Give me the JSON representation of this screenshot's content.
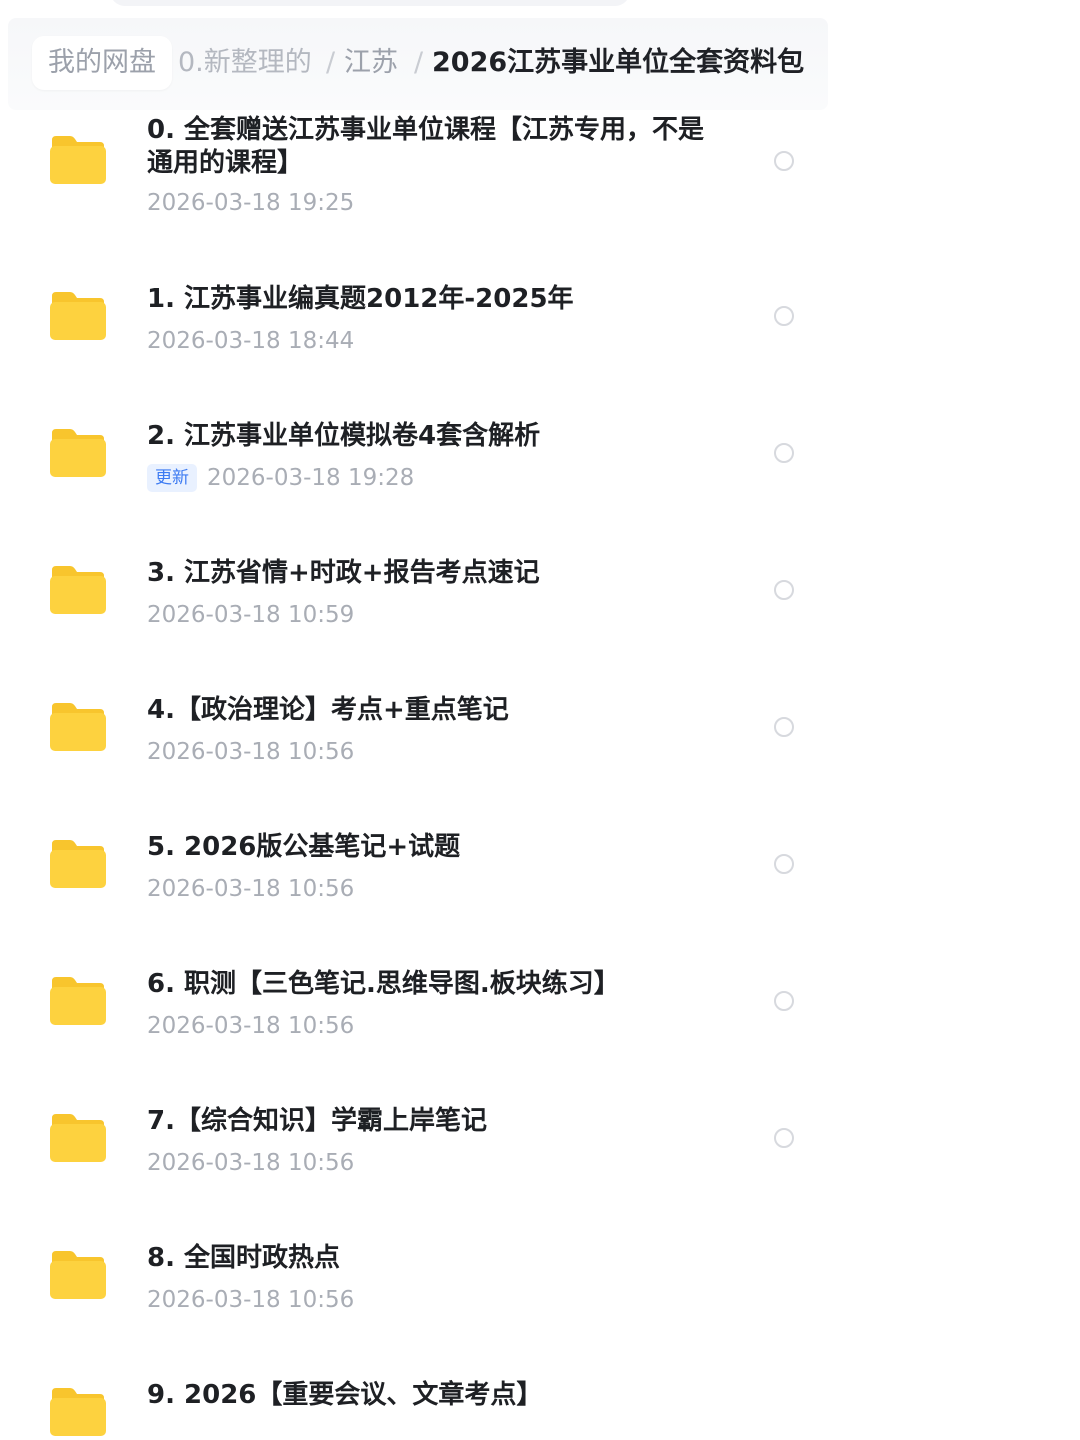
{
  "breadcrumb": {
    "root": "我的网盘",
    "faded": "0.新整理的",
    "separator": "/",
    "parent": "江苏",
    "current": "2026江苏事业单位全套资料包"
  },
  "files": [
    {
      "name": "0. 全套赠送江苏事业单位课程【江苏专用，不是通用的课程】",
      "date": "2026-03-18 19:25"
    },
    {
      "name": "1. 江苏事业编真题2012年-2025年",
      "date": "2026-03-18 18:44"
    },
    {
      "name": "2. 江苏事业单位模拟卷4套含解析",
      "date": "2026-03-18 19:28",
      "badge": "更新"
    },
    {
      "name": "3. 江苏省情+时政+报告考点速记",
      "date": "2026-03-18 10:59"
    },
    {
      "name": "4.【政治理论】考点+重点笔记",
      "date": "2026-03-18 10:56"
    },
    {
      "name": "5. 2026版公基笔记+试题",
      "date": "2026-03-18 10:56"
    },
    {
      "name": "6. 职测【三色笔记.思维导图.板块练习】",
      "date": "2026-03-18 10:56"
    },
    {
      "name": "7.【综合知识】学霸上岸笔记",
      "date": "2026-03-18 10:56"
    },
    {
      "name": "8. 全国时政热点",
      "date": "2026-03-18 10:56"
    },
    {
      "name": "9. 2026【重要会议、文章考点】",
      "date": ""
    }
  ],
  "colors": {
    "folder": "#fdd23f",
    "folder_tab": "#f8c52d",
    "badge_text": "#3d7bf2",
    "badge_bg": "#e9f1ff"
  }
}
